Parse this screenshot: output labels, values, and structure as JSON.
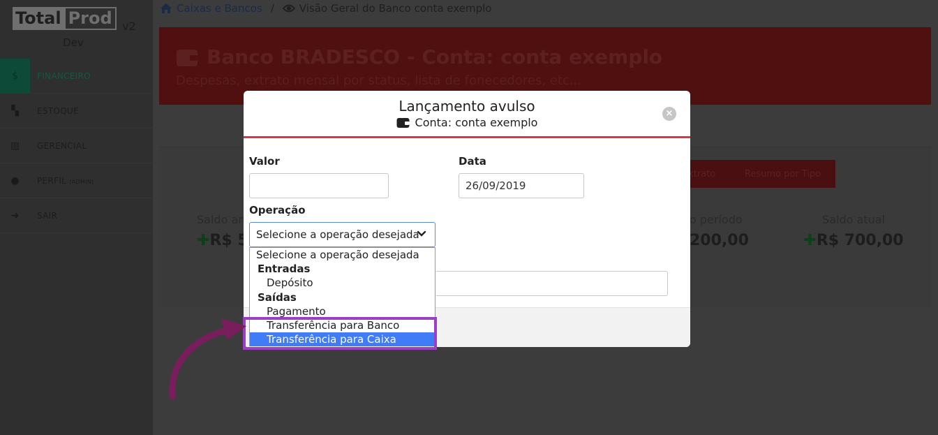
{
  "logo": {
    "part1": "Total",
    "part2": "Prod",
    "version": "v2",
    "env": "Dev"
  },
  "sidebar": {
    "items": [
      {
        "icon": "$",
        "label": "FINANCEIRO",
        "suffix": ""
      },
      {
        "icon": "▚",
        "label": "ESTOQUE",
        "suffix": ""
      },
      {
        "icon": "▥",
        "label": "GERENCIAL",
        "suffix": ""
      },
      {
        "icon": "●",
        "label": "PERFIL",
        "suffix": "(ADMIN)"
      },
      {
        "icon": "➔",
        "label": "SAIR",
        "suffix": ""
      }
    ]
  },
  "breadcrumb": {
    "link": "Caixas e Bancos",
    "separator": "/",
    "current": "Visão Geral do Banco conta exemplo"
  },
  "banner": {
    "title": "Banco BRADESCO - Conta: conta exemplo",
    "subtitle": "Despesas, extrato mensal por status, lista de fonecedores, etc..."
  },
  "bg_tabs": {
    "tab1": "Extrato",
    "tab2": "Resumo por Tipo"
  },
  "stats": {
    "left": {
      "label": "Saldo an",
      "value": "R$ 50"
    },
    "mid": {
      "label": "o período",
      "value": "200,00"
    },
    "right": {
      "label": "Saldo atual",
      "value": "R$ 700,00"
    }
  },
  "modal": {
    "title": "Lançamento avulso",
    "subtitle": "Conta: conta exemplo",
    "close": "×",
    "valor_label": "Valor",
    "valor_value": "",
    "data_label": "Data",
    "data_value": "26/09/2019",
    "operacao_label": "Operação",
    "operacao_selected": "Selecione a operação desejada",
    "chevron": "⌄"
  },
  "dropdown": {
    "placeholder": "Selecione a operação desejada",
    "group_entradas": "Entradas",
    "opt_deposito": "Depósito",
    "group_saidas": "Saídas",
    "opt_pagamento": "Pagamento",
    "opt_transf_banco": "Transferência para Banco",
    "opt_transf_caixa": "Transferência para Caixa"
  },
  "colors": {
    "accent_red": "#dc3545",
    "highlight": "#9b3fc4",
    "selected": "#3f7cf5"
  }
}
